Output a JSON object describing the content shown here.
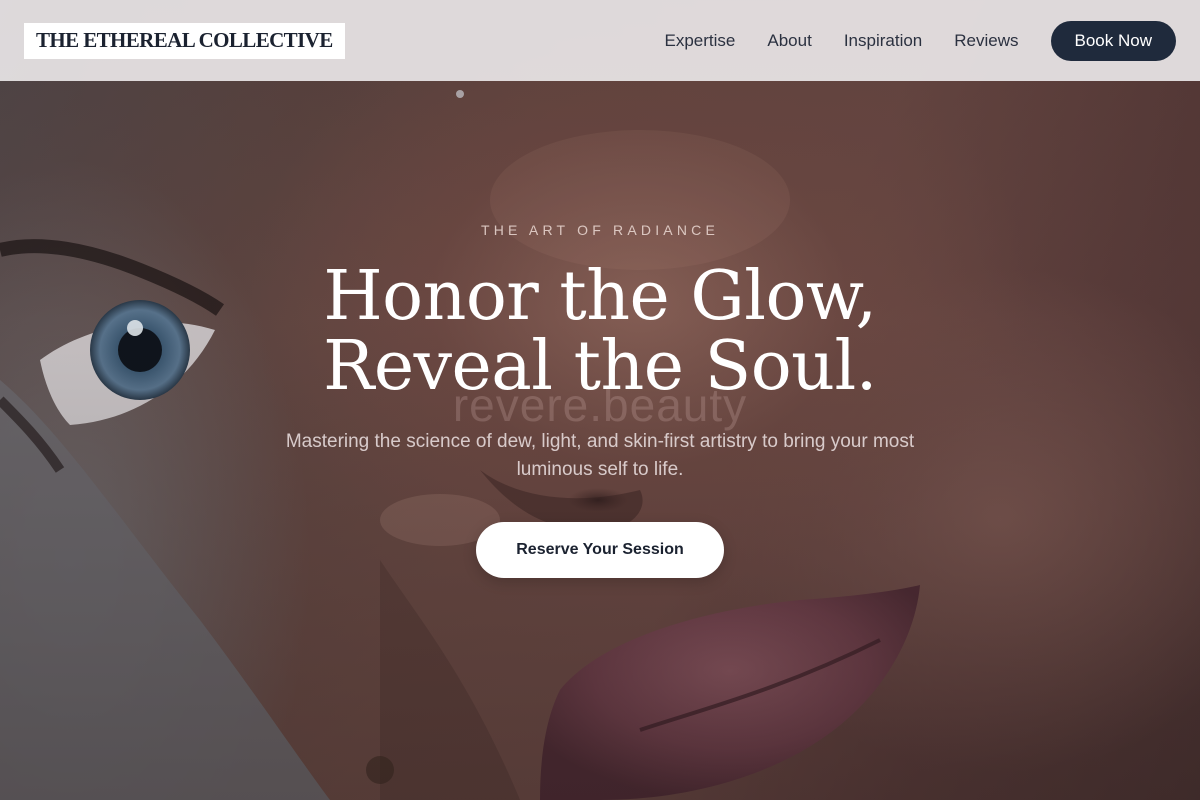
{
  "header": {
    "logo": "THE ETHEREAL COLLECTIVE",
    "nav": [
      {
        "label": "Expertise"
      },
      {
        "label": "About"
      },
      {
        "label": "Inspiration"
      },
      {
        "label": "Reviews"
      }
    ],
    "cta_label": "Book Now"
  },
  "hero": {
    "eyebrow": "THE ART OF RADIANCE",
    "headline_line1": "Honor the Glow,",
    "headline_line2": "Reveal the Soul.",
    "watermark": "revere.beauty",
    "subtext": "Mastering the science of dew, light, and skin-first artistry to bring your most luminous self to life.",
    "cta_label": "Reserve Your Session"
  },
  "colors": {
    "header_bg": "#e8e5e6",
    "brand_dark": "#1f2a3c",
    "text_dark": "#1b2230",
    "button_light": "#ffffff"
  }
}
